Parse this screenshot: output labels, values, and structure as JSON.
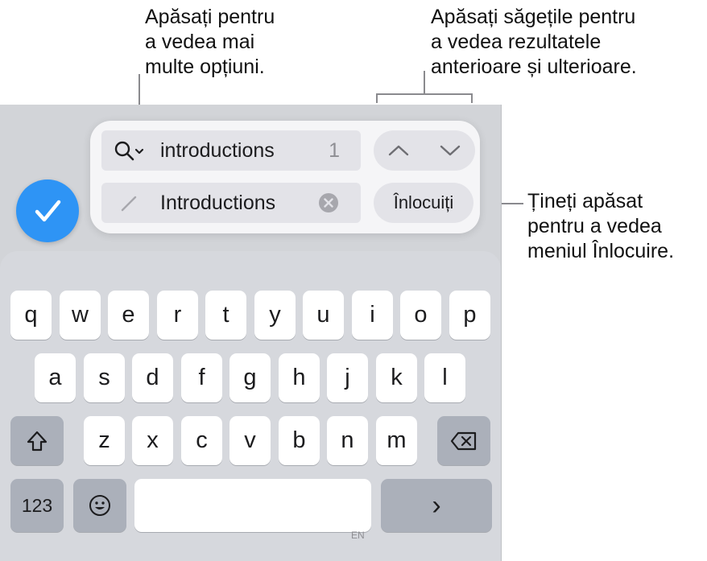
{
  "callouts": {
    "options": "Apăsați pentru\na vedea mai\nmulte opțiuni.",
    "arrows": "Apăsați săgețile pentru\na vedea rezultatele\nanterioare și ulterioare.",
    "replace": "Țineți apăsat\npentru a vedea\nmeniul Înlocuire."
  },
  "find": {
    "search_text": "introductions",
    "match_count": "1",
    "replace_text": "Introductions",
    "replace_button": "Înlocuiți"
  },
  "keyboard": {
    "row1": [
      "q",
      "w",
      "e",
      "r",
      "t",
      "y",
      "u",
      "i",
      "o",
      "p"
    ],
    "row2": [
      "a",
      "s",
      "d",
      "f",
      "g",
      "h",
      "j",
      "k",
      "l"
    ],
    "row3": [
      "z",
      "x",
      "c",
      "v",
      "b",
      "n",
      "m"
    ],
    "numbers_key": "123",
    "language": "EN",
    "return_symbol": "›"
  },
  "colors": {
    "accent": "#2e94f5",
    "background": "#d2d4d8",
    "key": "#ffffff",
    "function_key": "#abb0ba"
  }
}
